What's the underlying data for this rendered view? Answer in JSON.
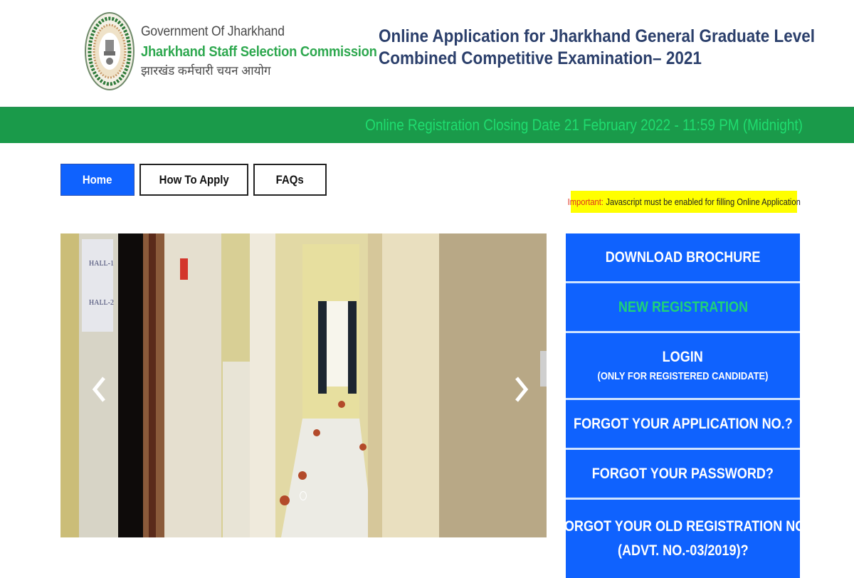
{
  "header": {
    "government": "Government Of Jharkhand",
    "organization": "Jharkhand Staff Selection Commission",
    "organization_hindi": "झारखंड कर्मचारी चयन आयोग",
    "title_line1": "Online Application for Jharkhand General Graduate Level",
    "title_line2": "Combined Competitive Examination– 2021"
  },
  "notice": {
    "text": "Online Registration Closing Date 21 February 2022 - 11:59 PM (Midnight)"
  },
  "nav": {
    "items": [
      {
        "label": "Home",
        "active": true
      },
      {
        "label": "How To Apply",
        "active": false
      },
      {
        "label": "FAQs",
        "active": false
      }
    ]
  },
  "important": {
    "label": "Important:",
    "text": "Javascript must be enabled for filling Online Application"
  },
  "carousel": {
    "image_alt": "Examination hall corridor",
    "prev_icon": "chevron-left-icon",
    "next_icon": "chevron-right-icon",
    "slide_count_visible": 1
  },
  "actions": [
    {
      "title": "DOWNLOAD BROCHURE"
    },
    {
      "title": "NEW REGISTRATION"
    },
    {
      "title": "LOGIN",
      "subtitle": "(ONLY FOR REGISTERED CANDIDATE)"
    },
    {
      "title": "FORGOT YOUR APPLICATION NO.?"
    },
    {
      "title": "FORGOT YOUR PASSWORD?"
    },
    {
      "title": "FORGOT YOUR OLD REGISTRATION NO.",
      "subtitle": "(ADVT. NO.-03/2019)?"
    }
  ],
  "colors": {
    "primary_blue": "#0f62fe",
    "notice_green": "#1a9a4a",
    "notice_text": "#1fdc6f",
    "title_navy": "#2b3f6b",
    "org_green": "#2ea84f",
    "important_bg": "#ffff00",
    "important_label": "#e0301e"
  }
}
